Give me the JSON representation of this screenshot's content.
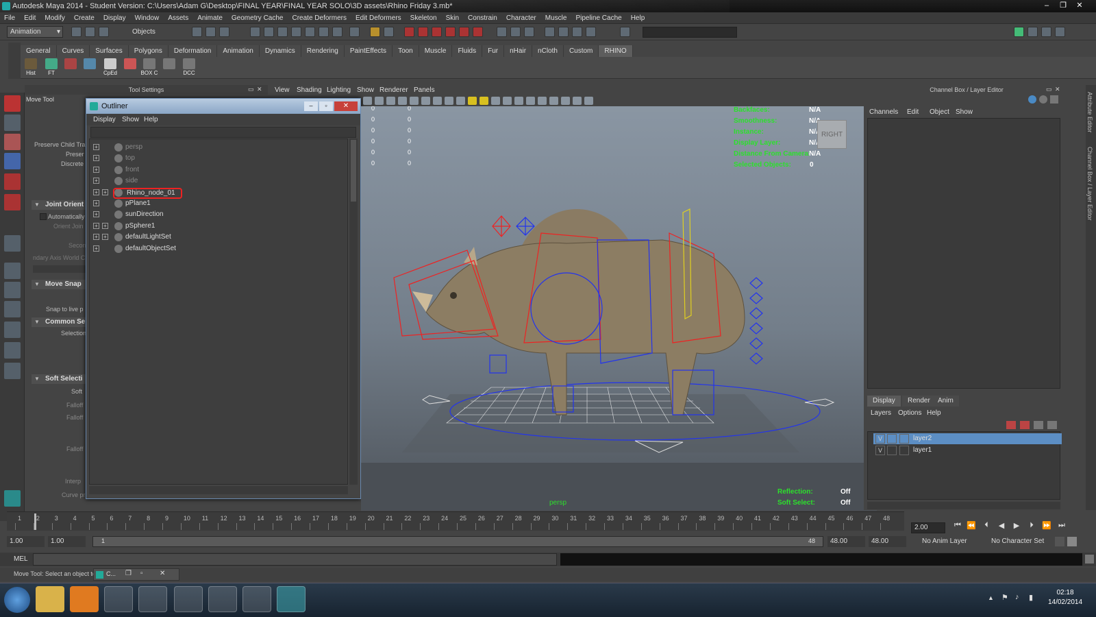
{
  "window": {
    "title": "Autodesk Maya 2014 - Student Version: C:\\Users\\Adam G\\Desktop\\FINAL YEAR\\FINAL YEAR SOLO\\3D assets\\Rhino Friday 3.mb*",
    "minimize": "–",
    "maximize": "❐",
    "close": "✕"
  },
  "menubar": [
    "File",
    "Edit",
    "Modify",
    "Create",
    "Display",
    "Window",
    "Assets",
    "Animate",
    "Geometry Cache",
    "Create Deformers",
    "Edit Deformers",
    "Skeleton",
    "Skin",
    "Constrain",
    "Character",
    "Muscle",
    "Pipeline Cache",
    "Help"
  ],
  "statusline": {
    "mode": "Animation",
    "selection": "Objects"
  },
  "shelf": {
    "tabs": [
      "General",
      "Curves",
      "Surfaces",
      "Polygons",
      "Deformation",
      "Animation",
      "Dynamics",
      "Rendering",
      "PaintEffects",
      "Toon",
      "Muscle",
      "Fluids",
      "Fur",
      "nHair",
      "nCloth",
      "Custom",
      "RHINO"
    ],
    "active_tab": "RHINO",
    "buttons": [
      "Hist",
      "FT",
      "",
      "",
      "CpEd",
      "",
      "BOX C",
      "",
      "DCC"
    ]
  },
  "tool_settings": {
    "header": "Tool Settings",
    "tool_name": "Move Tool",
    "labels": {
      "preserve_child": "Preserve Child Tra",
      "preser": "Preser",
      "discrete": "Discrete",
      "automatically": "Automatically",
      "orient_join": "Orient Join",
      "secon": "Secon",
      "boundary_axis": "ndary Axis World C",
      "snap_live": "Snap to live p",
      "selection": "Selection",
      "soft": "Soft",
      "falloff1": "Falloff",
      "falloff2": "Falloff",
      "falloff3": "Falloff",
      "interp": "Interp",
      "curve_presets": "Curve presets:"
    },
    "sections": [
      "Joint Orient",
      "Move Snap",
      "Common Se",
      "Soft Selecti"
    ]
  },
  "outliner": {
    "title": "Outliner",
    "menu": [
      "Display",
      "Show",
      "Help"
    ],
    "items": [
      {
        "label": "persp",
        "dim": true
      },
      {
        "label": "top",
        "dim": true
      },
      {
        "label": "front",
        "dim": true
      },
      {
        "label": "side",
        "dim": true
      },
      {
        "label": "Rhino_node_01",
        "selected": true
      },
      {
        "label": "pPlane1"
      },
      {
        "label": "sunDirection"
      },
      {
        "label": "pSphere1"
      },
      {
        "label": "defaultLightSet"
      },
      {
        "label": "defaultObjectSet"
      }
    ]
  },
  "panel_menu": [
    "View",
    "Shading",
    "Lighting",
    "Show",
    "Renderer",
    "Panels"
  ],
  "viewport": {
    "hud": [
      {
        "label": "Backfaces:",
        "value": "N/A"
      },
      {
        "label": "Smoothness:",
        "value": "N/A"
      },
      {
        "label": "Instance:",
        "value": "N/A"
      },
      {
        "label": "Display Layer:",
        "value": "N/A"
      },
      {
        "label": "Distance From Camera:",
        "value": "N/A"
      },
      {
        "label": "Selected Objects:",
        "value": "0"
      }
    ],
    "hud_bottom": [
      {
        "label": "Reflection:",
        "value": "Off"
      },
      {
        "label": "Soft Select:",
        "value": "Off"
      }
    ],
    "poly_counts": [
      "0",
      "0",
      "0",
      "0",
      "0",
      "0",
      "0",
      "0",
      "0",
      "0",
      "0",
      "0"
    ],
    "camera": "persp",
    "view_cube": "RIGHT"
  },
  "channel_box": {
    "header": "Channel Box / Layer Editor",
    "menu": [
      "Channels",
      "Edit",
      "Object",
      "Show"
    ],
    "layer_tabs": [
      "Display",
      "Render",
      "Anim"
    ],
    "layer_menu": [
      "Layers",
      "Options",
      "Help"
    ],
    "layers": [
      {
        "v": "V",
        "name": "layer2",
        "active": true
      },
      {
        "v": "V",
        "name": "layer1",
        "active": false
      }
    ],
    "side_labels": [
      "Attribute Editor",
      "Channel Box / Layer Editor"
    ]
  },
  "timeline": {
    "ticks": [
      "1",
      "2",
      "3",
      "4",
      "5",
      "6",
      "7",
      "8",
      "9",
      "10",
      "11",
      "12",
      "13",
      "14",
      "15",
      "16",
      "17",
      "18",
      "19",
      "20",
      "21",
      "22",
      "23",
      "24",
      "25",
      "26",
      "27",
      "28",
      "29",
      "30",
      "31",
      "32",
      "33",
      "34",
      "35",
      "36",
      "37",
      "38",
      "39",
      "40",
      "41",
      "42",
      "43",
      "44",
      "45",
      "46",
      "47",
      "48"
    ],
    "current_time": "2.00"
  },
  "range": {
    "start": "1.00",
    "playback_start": "1.00",
    "marker": "1",
    "end_marker": "48",
    "playback_end": "48.00",
    "end": "48.00",
    "anim_layer": "No Anim Layer",
    "character_set": "No Character Set"
  },
  "cmdline": {
    "label": "MEL"
  },
  "helpline": {
    "text": "Move Tool: Select an object to",
    "task_label": "C..."
  },
  "taskbar": {
    "time": "02:18",
    "date": "14/02/2014"
  }
}
